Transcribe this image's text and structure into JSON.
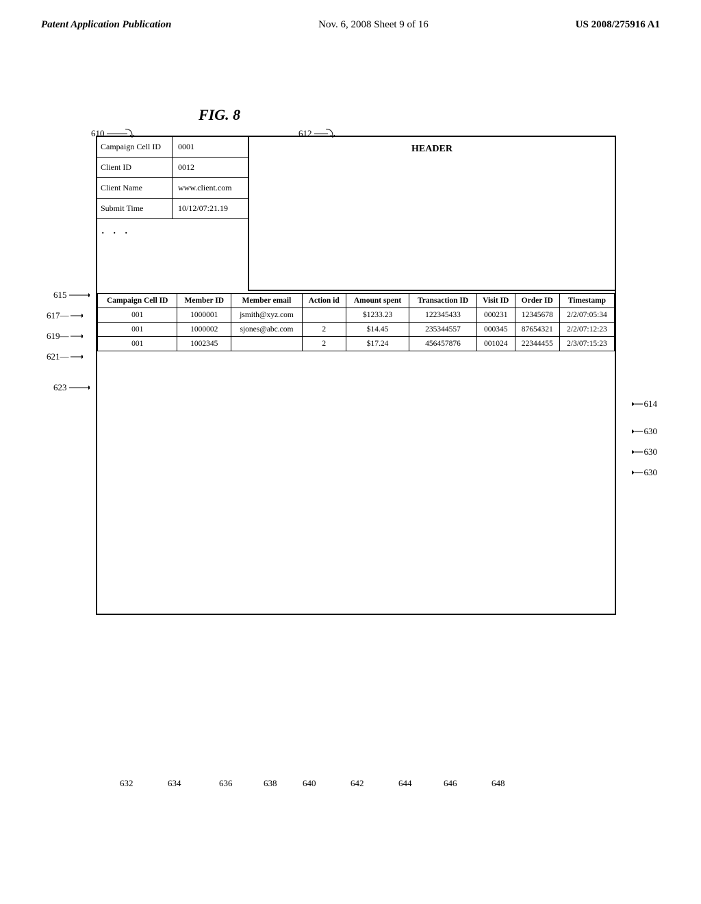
{
  "header": {
    "left": "Patent Application Publication",
    "center": "Nov. 6, 2008     Sheet 9 of 16",
    "right": "US 2008/275916 A1"
  },
  "figure": {
    "title": "FIG. 8"
  },
  "labels": {
    "fig_num_610": "610",
    "fig_num_612": "612",
    "label_615": "615",
    "label_617": "617—",
    "label_619": "619—",
    "label_621": "621—",
    "label_623": "623",
    "label_614": "614",
    "label_630a": "630",
    "label_630b": "630",
    "label_630c": "630",
    "label_632": "632",
    "label_634": "634",
    "label_636": "636",
    "label_638": "638",
    "label_640": "640",
    "label_642": "642",
    "label_644": "644",
    "label_646": "646",
    "label_648": "648"
  },
  "header_section": {
    "label": "HEADER"
  },
  "left_rows": [
    {
      "label": "Campaign Cell ID",
      "value": "0001"
    },
    {
      "label": "Client ID",
      "value": "0012"
    },
    {
      "label": "Client Name",
      "value": "www.client.com"
    },
    {
      "label": "Submit Time",
      "value": "10/12/07:21.19"
    }
  ],
  "data_table": {
    "headers": [
      "Campaign Cell ID",
      "Member ID",
      "Member email",
      "Action id",
      "Amount spent",
      "Transaction ID",
      "Visit ID",
      "Order ID",
      "Timestamp"
    ],
    "rows": [
      {
        "campaign_cell_id": "001",
        "member_id": "1000001",
        "member_email": "jsmith@xyz.com",
        "action_id": "",
        "amount_spent": "$1233.23",
        "transaction_id": "122345433",
        "visit_id": "000231",
        "order_id": "12345678",
        "timestamp": "2/2/07:05:34"
      },
      {
        "campaign_cell_id": "001",
        "member_id": "1000002",
        "member_email": "sjones@abc.com",
        "action_id": "2",
        "amount_spent": "$14.45",
        "transaction_id": "235344557",
        "visit_id": "000345",
        "order_id": "87654321",
        "timestamp": "2/2/07:12:23"
      },
      {
        "campaign_cell_id": "001",
        "member_id": "1002345",
        "member_email": "",
        "action_id": "2",
        "amount_spent": "$17.24",
        "transaction_id": "456457876",
        "visit_id": "001024",
        "order_id": "22344455",
        "timestamp": "2/3/07:15:23"
      }
    ]
  }
}
